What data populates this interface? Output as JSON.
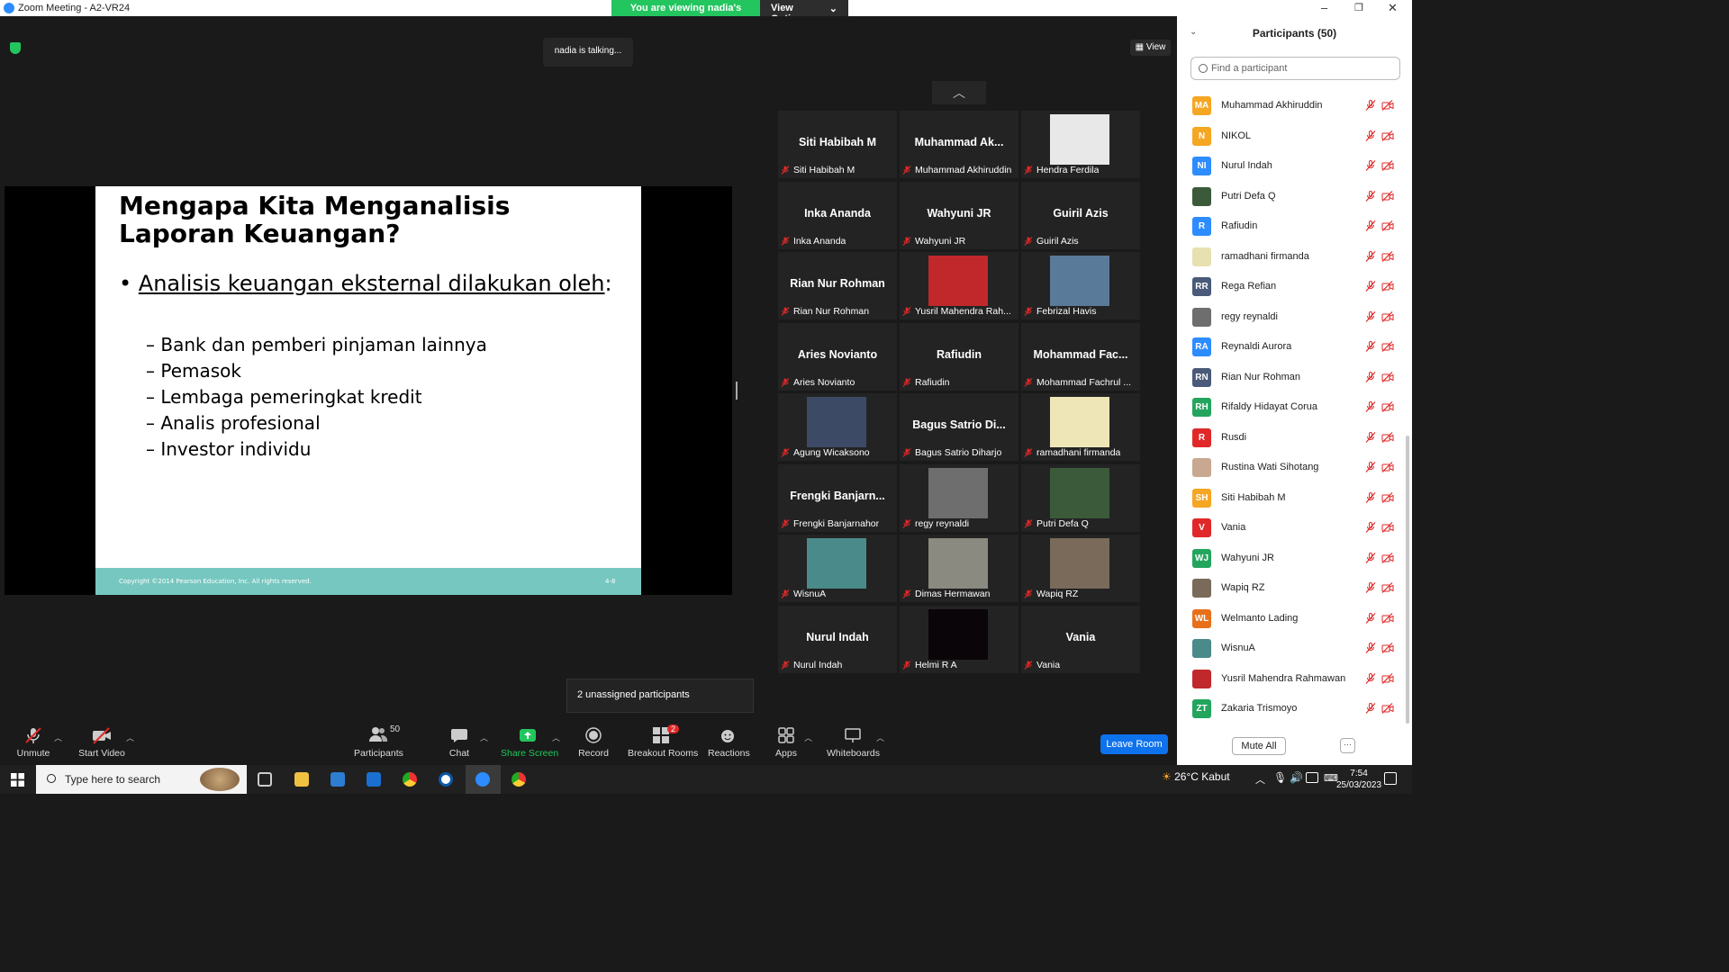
{
  "window": {
    "title": "Zoom Meeting - A2-VR24"
  },
  "banner": {
    "viewing": "You are viewing nadia's screen",
    "view_options": "View Options"
  },
  "stage": {
    "talking": "nadia is talking...",
    "view_label": "View",
    "unassigned": "2 unassigned participants"
  },
  "slide": {
    "title": "Mengapa Kita Menganalisis Laporan Keuangan?",
    "bullet": "Analisis keuangan eksternal dilakukan oleh",
    "bullet_suffix": ":",
    "items": [
      "– Bank dan pemberi pinjaman lainnya",
      "– Pemasok",
      "– Lembaga pemeringkat kredit",
      "– Analis profesional",
      "– Investor individu"
    ],
    "copyright": "Copyright ©2014 Pearson Education, Inc. All rights reserved.",
    "page": "4-8"
  },
  "tiles": [
    {
      "big": "Siti Habibah M",
      "label": "Siti Habibah M"
    },
    {
      "big": "Muhammad  Ak...",
      "label": "Muhammad Akhiruddin"
    },
    {
      "photo": "#e8e8e8",
      "label": "Hendra Ferdila"
    },
    {
      "big": "Inka Ananda",
      "label": "Inka Ananda"
    },
    {
      "big": "Wahyuni JR",
      "label": "Wahyuni JR"
    },
    {
      "big": "Guiril Azis",
      "label": "Guiril Azis"
    },
    {
      "big": "Rian Nur Rohman",
      "label": "Rian Nur Rohman"
    },
    {
      "photo": "#c0282b",
      "label": "Yusril Mahendra Rah..."
    },
    {
      "photo": "#5a7a9a",
      "label": "Febrizal Havis"
    },
    {
      "big": "Aries Novianto",
      "label": "Aries Novianto"
    },
    {
      "big": "Rafiudin",
      "label": "Rafiudin"
    },
    {
      "big": "Mohammad  Fac...",
      "label": "Mohammad Fachrul ..."
    },
    {
      "photo": "#3c4a66",
      "label": "Agung Wicaksono"
    },
    {
      "big": "Bagus Satrio  Di...",
      "label": "Bagus Satrio Diharjo"
    },
    {
      "photo": "#efe6b8",
      "label": "ramadhani firmanda"
    },
    {
      "big": "Frengki  Banjarn...",
      "label": "Frengki Banjarnahor"
    },
    {
      "photo": "#6e6e6e",
      "label": "regy reynaldi"
    },
    {
      "photo": "#3a5a3a",
      "label": "Putri Defa Q"
    },
    {
      "photo": "#4a8a8a",
      "label": "WisnuA"
    },
    {
      "photo": "#8a8a80",
      "label": "Dimas Hermawan"
    },
    {
      "photo": "#7a6a5a",
      "label": "Wapiq RZ"
    },
    {
      "big": "Nurul Indah",
      "label": "Nurul Indah"
    },
    {
      "photo": "#0a0508",
      "label": "Helmi R A"
    },
    {
      "big": "Vania",
      "label": "Vania"
    }
  ],
  "toolbar": {
    "unmute": "Unmute",
    "start_video": "Start Video",
    "participants": "Participants",
    "participants_count": "50",
    "chat": "Chat",
    "share_screen": "Share Screen",
    "record": "Record",
    "breakout": "Breakout Rooms",
    "breakout_badge": "2",
    "reactions": "Reactions",
    "apps": "Apps",
    "whiteboards": "Whiteboards",
    "leave": "Leave Room"
  },
  "panel": {
    "header": "Participants (50)",
    "search_placeholder": "Find a participant",
    "mute_all": "Mute All",
    "more": "···",
    "participants": [
      {
        "initials": "MA",
        "name": "Muhammad Akhiruddin",
        "color": "#f5a623"
      },
      {
        "initials": "N",
        "name": "NIKOL",
        "color": "#f5a623"
      },
      {
        "initials": "NI",
        "name": "Nurul Indah",
        "color": "#2d8cff"
      },
      {
        "initials": "",
        "name": "Putri Defa Q",
        "color": "#3a5a3a"
      },
      {
        "initials": "R",
        "name": "Rafiudin",
        "color": "#2d8cff"
      },
      {
        "initials": "",
        "name": "ramadhani firmanda",
        "color": "#e7e0b0"
      },
      {
        "initials": "RR",
        "name": "Rega Refian",
        "color": "#4a5a78"
      },
      {
        "initials": "",
        "name": "regy reynaldi",
        "color": "#6e6e6e"
      },
      {
        "initials": "RA",
        "name": "Reynaldi Aurora",
        "color": "#2d8cff"
      },
      {
        "initials": "RN",
        "name": "Rian Nur Rohman",
        "color": "#4a5a78"
      },
      {
        "initials": "RH",
        "name": "Rifaldy Hidayat Corua",
        "color": "#23a55e"
      },
      {
        "initials": "R",
        "name": "Rusdi",
        "color": "#e02828"
      },
      {
        "initials": "",
        "name": "Rustina Wati Sihotang",
        "color": "#c8a890"
      },
      {
        "initials": "SH",
        "name": "Siti Habibah M",
        "color": "#f5a623"
      },
      {
        "initials": "V",
        "name": "Vania",
        "color": "#e02828"
      },
      {
        "initials": "WJ",
        "name": "Wahyuni JR",
        "color": "#23a55e"
      },
      {
        "initials": "",
        "name": "Wapiq RZ",
        "color": "#7a6a5a"
      },
      {
        "initials": "WL",
        "name": "Welmanto Lading",
        "color": "#e8701a"
      },
      {
        "initials": "",
        "name": "WisnuA",
        "color": "#4a8a8a"
      },
      {
        "initials": "",
        "name": "Yusril Mahendra Rahmawan",
        "color": "#c0282b"
      },
      {
        "initials": "ZT",
        "name": "Zakaria Trismoyo",
        "color": "#23a55e"
      }
    ]
  },
  "taskbar": {
    "search": "Type here to search",
    "weather": "26°C  Kabut",
    "time": "7:54",
    "date": "25/03/2023"
  },
  "colors": {
    "accent": "#2d8cff",
    "green": "#23c55e",
    "muted_red": "#e02828",
    "leave": "#0e72ed"
  }
}
